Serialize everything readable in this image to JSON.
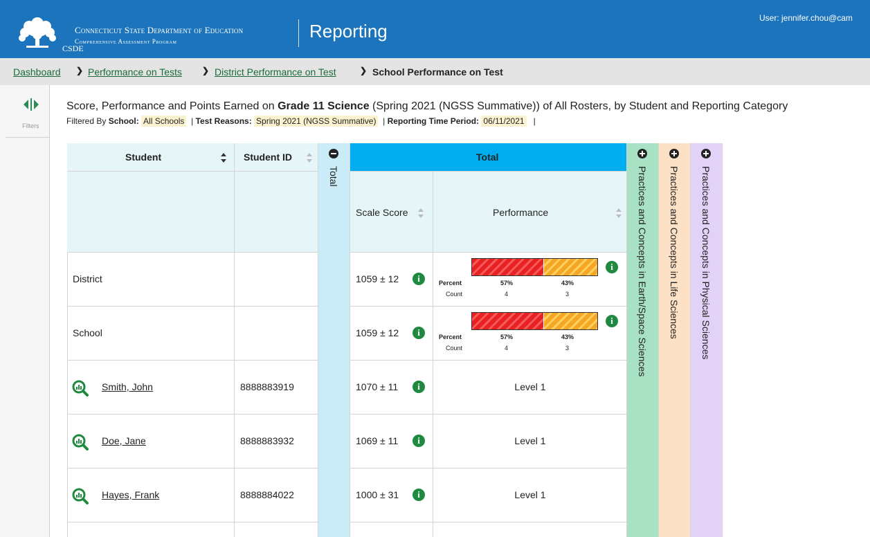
{
  "header": {
    "logo_text": "CSDE",
    "org_line1": "Connecticut State Department of Education",
    "org_line2": "Comprehensive Assessment Program",
    "app_title": "Reporting",
    "user": "User: jennifer.chou@cam"
  },
  "breadcrumb": {
    "items": [
      "Dashboard",
      "Performance on Tests",
      "District Performance on Test"
    ],
    "current": "School Performance on Test"
  },
  "sidebar": {
    "filters_label": "Filters"
  },
  "report": {
    "title_prefix": "Score, Performance and Points Earned on ",
    "title_bold": "Grade 11 Science",
    "title_suffix": " (Spring 2021 (NGSS Summative)) of All Rosters, by Student and Reporting Category",
    "filtered_by": "Filtered By",
    "school_label": "School:",
    "school_value": "All Schools",
    "test_reasons_label": "Test Reasons:",
    "test_reasons_value": "Spring 2021 (NGSS Summative)",
    "period_label": "Reporting Time Period:",
    "period_value": "06/11/2021",
    "sep": "|"
  },
  "table": {
    "col_student": "Student",
    "col_student_id": "Student ID",
    "col_total_collapsed": "Total",
    "col_total_group": "Total",
    "col_scale_score": "Scale Score",
    "col_performance": "Performance",
    "categories": [
      "Practices and Concepts in Earth/Space Sciences",
      "Practices and Concepts in Life Sciences",
      "Practices and Concepts in Physical Sciences"
    ],
    "summary_rows": [
      {
        "name": "District",
        "scale": "1059 ± 12",
        "percent_label": "Percent",
        "count_label": "Count",
        "p1": "57%",
        "p2": "43%",
        "c1": "4",
        "c2": "3",
        "frac1": 0.57
      },
      {
        "name": "School",
        "scale": "1059 ± 12",
        "percent_label": "Percent",
        "count_label": "Count",
        "p1": "57%",
        "p2": "43%",
        "c1": "4",
        "c2": "3",
        "frac1": 0.57
      }
    ],
    "students": [
      {
        "name": "Smith, John",
        "id": "8888883919",
        "scale": "1070 ± 11",
        "level": "Level 1"
      },
      {
        "name": "Doe, Jane",
        "id": "8888883932",
        "scale": "1069 ± 11",
        "level": "Level 1"
      },
      {
        "name": "Hayes, Frank",
        "id": "8888884022",
        "scale": "1000 ± 31",
        "level": "Level 1"
      }
    ]
  },
  "colors": {
    "header_bg": "#1c75bc",
    "total_group_bg": "#00aeef",
    "total_collapsed_bg": "#c9ecf8",
    "earth_bg": "#a8e1c4",
    "life_bg": "#fde1c6",
    "physical_bg": "#e2d2f7"
  }
}
